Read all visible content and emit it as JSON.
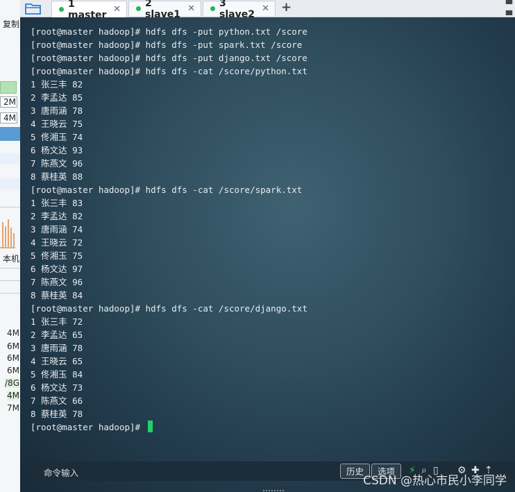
{
  "sidebar": {
    "copy_label": "复制",
    "mem_values_top": [
      "2M",
      "4M"
    ],
    "host_label": "本机",
    "mem_values_bottom": [
      "4M",
      "6M",
      "6M",
      "6M",
      "/8G",
      "4M",
      "7M"
    ]
  },
  "tabs": [
    {
      "label": "1 master",
      "status_color": "#1db954",
      "active": true
    },
    {
      "label": "2 slave1",
      "status_color": "#1db954",
      "active": false
    },
    {
      "label": "3 slave2",
      "status_color": "#1db954",
      "active": false
    }
  ],
  "terminal": {
    "lines": [
      "[root@master hadoop]# hdfs dfs -put python.txt /score",
      "[root@master hadoop]# hdfs dfs -put spark.txt /score",
      "[root@master hadoop]# hdfs dfs -put django.txt /score",
      "[root@master hadoop]# hdfs dfs -cat /score/python.txt",
      "1 张三丰 82",
      "2 李孟达 85",
      "3 唐雨涵 78",
      "4 王晓云 75",
      "5 佟湘玉 74",
      "6 杨文达 93",
      "7 陈燕文 96",
      "8 蔡桂英 88",
      "[root@master hadoop]# hdfs dfs -cat /score/spark.txt",
      "1 张三丰 83",
      "2 李孟达 82",
      "3 唐雨涵 74",
      "4 王晓云 72",
      "5 佟湘玉 75",
      "6 杨文达 97",
      "7 陈燕文 96",
      "8 蔡桂英 84",
      "[root@master hadoop]# hdfs dfs -cat /score/django.txt",
      "1 张三丰 72",
      "2 李孟达 65",
      "3 唐雨涵 78",
      "4 王晓云 65",
      "5 佟湘玉 84",
      "6 杨文达 73",
      "7 陈燕文 66",
      "8 蔡桂英 78"
    ],
    "prompt": "[root@master hadoop]# "
  },
  "command_bar": {
    "label": "命令输入",
    "history_button": "历史",
    "options_button": "选项"
  },
  "watermark": "CSDN @热心市民小李同学"
}
